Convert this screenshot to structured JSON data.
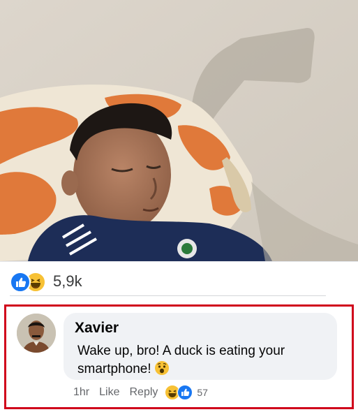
{
  "post": {
    "photo": {
      "subject": "boy-sleeping-on-pillow",
      "colors": {
        "wall": "#d9d3ca",
        "pillow_orange": "#e0793a",
        "pillow_cream": "#efe6d5",
        "jacket": "#1d2d57"
      }
    }
  },
  "reactions": {
    "count": "5,9k",
    "icons": [
      "like-icon",
      "haha-icon"
    ],
    "colors": {
      "like": "#1877f2",
      "haha": "#f7c135"
    }
  },
  "comment": {
    "author": "Xavier",
    "text": "Wake up, bro! A duck is eating your smartphone!",
    "emoji": "wow-face-emoji",
    "time": "1hr",
    "like_label": "Like",
    "reply_label": "Reply",
    "reaction_count": "57",
    "highlight_color": "#d0021b"
  }
}
